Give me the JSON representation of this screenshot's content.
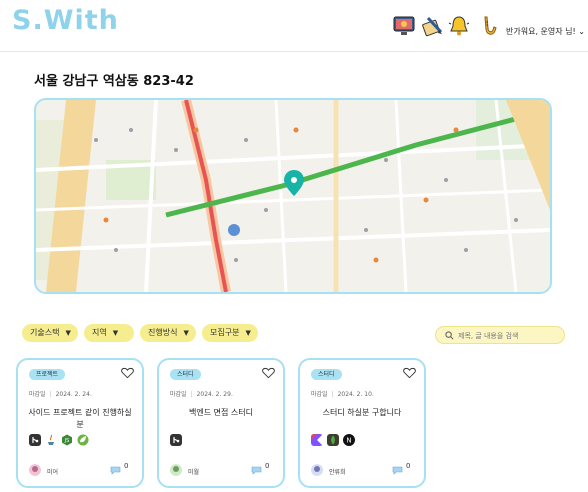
{
  "header": {
    "logo": "S.With",
    "greeting": "반가워요, 운영자 님!",
    "greeting_chevron": "⌄",
    "icons": [
      "monitor-icon",
      "write-icon",
      "bell-icon",
      "saxophone-icon"
    ]
  },
  "location": {
    "address": "서울 강남구 역삼동 823-42",
    "map_provider": "kakao"
  },
  "filters": [
    {
      "label": "기술스택"
    },
    {
      "label": "지역"
    },
    {
      "label": "진행방식"
    },
    {
      "label": "모집구분"
    }
  ],
  "search": {
    "placeholder": "제목, 글 내용을 검색"
  },
  "cards": [
    {
      "category": "프로젝트",
      "deadline_label": "마감일",
      "deadline": "2024. 2. 24.",
      "title": "사이드 프로젝트 같이 진행하실 분",
      "stacks": [
        "git-icon",
        "java-icon",
        "nodejs-icon",
        "spring-icon"
      ],
      "author": "미어",
      "comments": "0"
    },
    {
      "category": "스터디",
      "deadline_label": "마감일",
      "deadline": "2024. 2. 29.",
      "title": "백엔드 면접 스터디",
      "stacks": [
        "git-icon"
      ],
      "author": "미월",
      "comments": "0"
    },
    {
      "category": "스터디",
      "deadline_label": "마감일",
      "deadline": "2024. 2. 10.",
      "title": "스터디 하실분 구합니다",
      "stacks": [
        "kotlin-icon",
        "mongodb-icon",
        "nextjs-icon"
      ],
      "author": "안류희",
      "comments": "0"
    }
  ],
  "colors": {
    "accent": "#a6e1f2",
    "chip": "#f6ee8e",
    "badge": "#a8e2f3",
    "logo": "#8fd3ea"
  }
}
